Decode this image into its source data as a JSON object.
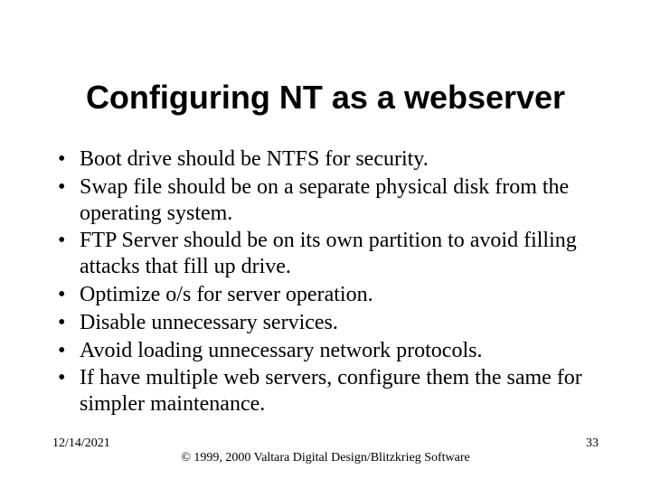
{
  "title": "Configuring NT as a webserver",
  "bullets": [
    "Boot drive should be NTFS for security.",
    "Swap file should be on a separate physical disk from the operating system.",
    "FTP Server should be on its own partition to avoid filling attacks that fill up drive.",
    "Optimize o/s for server operation.",
    "Disable unnecessary services.",
    "Avoid loading unnecessary network protocols.",
    "If have multiple web servers, configure them the same for simpler maintenance."
  ],
  "footer": {
    "date": "12/14/2021",
    "copyright": "© 1999, 2000 Valtara Digital Design/Blitzkrieg Software",
    "page": "33"
  }
}
